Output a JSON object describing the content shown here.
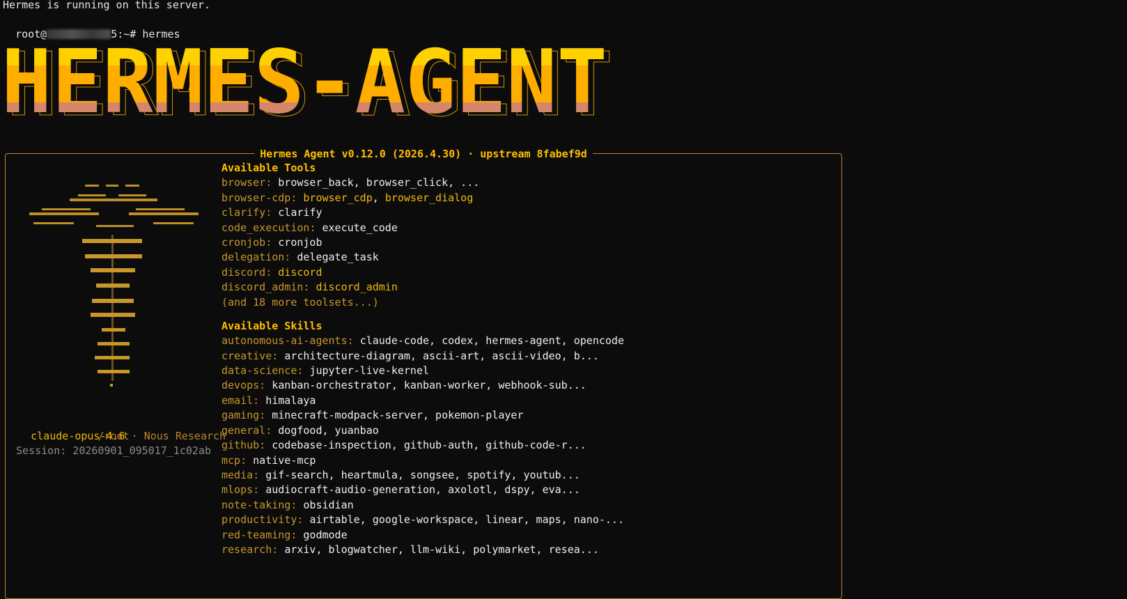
{
  "terminal": {
    "line1": "Hermes is running on this server.",
    "prompt_user": "root@",
    "prompt_host_suffix": "5:~# ",
    "prompt_command": "hermes"
  },
  "banner": {
    "text": "HERMES-AGENT",
    "colors": {
      "top": "#ffd100",
      "middle": "#ffae00",
      "bottom": "#d4876a"
    }
  },
  "panel": {
    "title": "Hermes Agent v0.12.0 (2026.4.30) · upstream 8fabef9d",
    "border_color": "#b8862b",
    "model": "claude-opus-4.6",
    "separator": "·",
    "provider": "Nous Research",
    "cwd": "/root",
    "session": "Session: 20260901_095017_1c02ab",
    "tools": {
      "heading": "Available Tools",
      "rows": [
        {
          "category": "browser:",
          "values": [
            {
              "text": "browser_back, browser_click, ...",
              "highlight": false
            }
          ]
        },
        {
          "category": "browser-cdp:",
          "values": [
            {
              "text": "browser_cdp",
              "highlight": true
            },
            {
              "text": ", ",
              "highlight": false
            },
            {
              "text": "browser_dialog",
              "highlight": true
            }
          ]
        },
        {
          "category": "clarify:",
          "values": [
            {
              "text": "clarify",
              "highlight": false
            }
          ]
        },
        {
          "category": "code_execution:",
          "values": [
            {
              "text": "execute_code",
              "highlight": false
            }
          ]
        },
        {
          "category": "cronjob:",
          "values": [
            {
              "text": "cronjob",
              "highlight": false
            }
          ]
        },
        {
          "category": "delegation:",
          "values": [
            {
              "text": "delegate_task",
              "highlight": false
            }
          ]
        },
        {
          "category": "discord:",
          "values": [
            {
              "text": "discord",
              "highlight": true
            }
          ]
        },
        {
          "category": "discord_admin:",
          "values": [
            {
              "text": "discord_admin",
              "highlight": true
            }
          ]
        }
      ],
      "more": "(and 18 more toolsets...)"
    },
    "skills": {
      "heading": "Available Skills",
      "rows": [
        {
          "category": "autonomous-ai-agents:",
          "value": "claude-code, codex, hermes-agent, opencode"
        },
        {
          "category": "creative:",
          "value": "architecture-diagram, ascii-art, ascii-video, b..."
        },
        {
          "category": "data-science:",
          "value": "jupyter-live-kernel"
        },
        {
          "category": "devops:",
          "value": "kanban-orchestrator, kanban-worker, webhook-sub..."
        },
        {
          "category": "email:",
          "value": "himalaya"
        },
        {
          "category": "gaming:",
          "value": "minecraft-modpack-server, pokemon-player"
        },
        {
          "category": "general:",
          "value": "dogfood, yuanbao"
        },
        {
          "category": "github:",
          "value": "codebase-inspection, github-auth, github-code-r..."
        },
        {
          "category": "mcp:",
          "value": "native-mcp"
        },
        {
          "category": "media:",
          "value": "gif-search, heartmula, songsee, spotify, youtub..."
        },
        {
          "category": "mlops:",
          "value": "audiocraft-audio-generation, axolotl, dspy, eva..."
        },
        {
          "category": "note-taking:",
          "value": "obsidian"
        },
        {
          "category": "productivity:",
          "value": "airtable, google-workspace, linear, maps, nano-..."
        },
        {
          "category": "red-teaming:",
          "value": "godmode"
        },
        {
          "category": "research:",
          "value": "arxiv, blogwatcher, llm-wiki, polymarket, resea..."
        }
      ]
    },
    "accent_color": "#ffbf00",
    "category_color": "#c8962b"
  }
}
